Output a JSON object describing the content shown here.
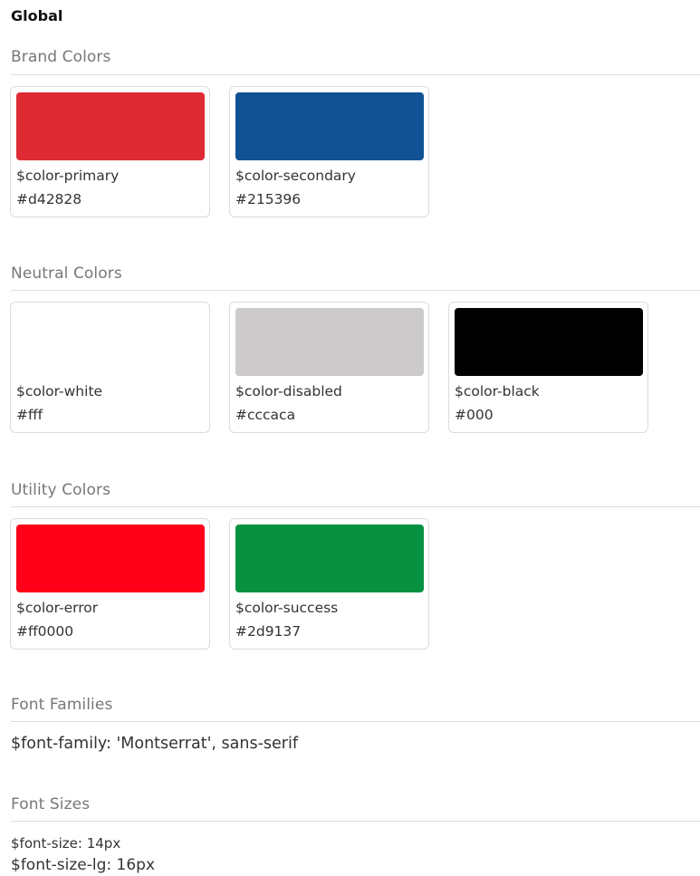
{
  "page": {
    "title": "Global"
  },
  "sections": {
    "brand": {
      "title": "Brand Colors",
      "items": [
        {
          "name": "$color-primary",
          "hex": "#d42828",
          "swatch": "#de2b33"
        },
        {
          "name": "$color-secondary",
          "hex": "#215396",
          "swatch": "#105294"
        }
      ]
    },
    "neutral": {
      "title": "Neutral Colors",
      "items": [
        {
          "name": "$color-white",
          "hex": "#fff",
          "swatch": "#ffffff"
        },
        {
          "name": "$color-disabled",
          "hex": "#cccaca",
          "swatch": "#cccaca"
        },
        {
          "name": "$color-black",
          "hex": "#000",
          "swatch": "#000000"
        }
      ]
    },
    "utility": {
      "title": "Utility Colors",
      "items": [
        {
          "name": "$color-error",
          "hex": "#ff0000",
          "swatch": "#ff0019"
        },
        {
          "name": "$color-success",
          "hex": "#2d9137",
          "swatch": "#079140"
        }
      ]
    },
    "font_families": {
      "title": "Font Families",
      "value": "$font-family: 'Montserrat', sans-serif"
    },
    "font_sizes": {
      "title": "Font Sizes",
      "base": "$font-size: 14px",
      "large": "$font-size-lg: 16px"
    }
  }
}
